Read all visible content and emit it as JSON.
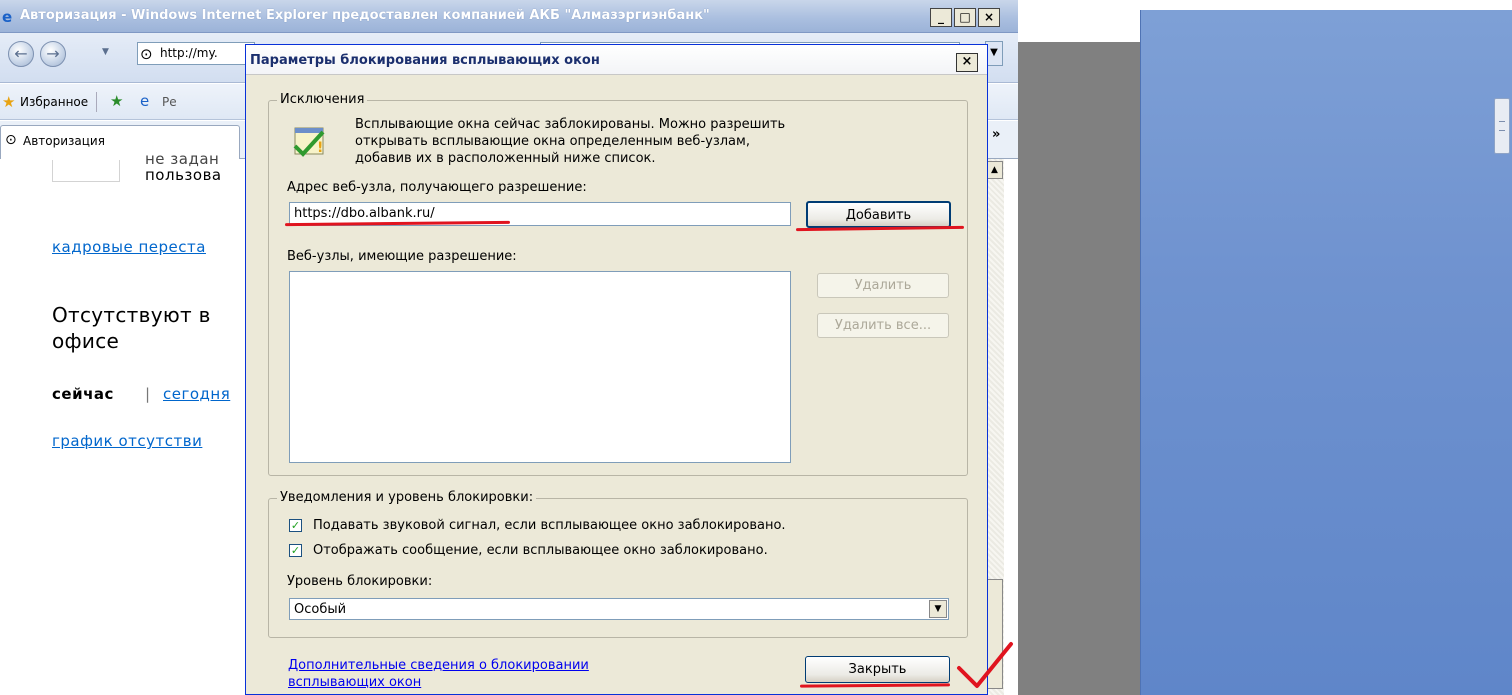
{
  "ie": {
    "title": "Авторизация - Windows Internet Explorer предоставлен компанией АКБ \"Алмазэргиэнбанк\"",
    "address_partial": "http://my.",
    "favorites_label": "Избранное",
    "favorites_extra": "Ре",
    "tab_label": "Авторизация",
    "more_tabs": "»"
  },
  "page": {
    "line1": "не задан",
    "line2": "пользова",
    "link_staff": "кадровые переста",
    "heading_line1": "Отсутствуют в",
    "heading_line2": "офисе",
    "now_label": "сейчас",
    "sep": "|",
    "today_link": "сегодня",
    "schedule_link": "график отсутстви"
  },
  "dialog": {
    "title": "Параметры блокирования всплывающих окон",
    "close_glyph": "×",
    "exceptions_legend": "Исключения",
    "info_line1": "Всплывающие окна сейчас заблокированы.  Можно разрешить",
    "info_line2": "открывать всплывающие окна определенным веб-узлам,",
    "info_line3": "добавив их в расположенный ниже список.",
    "address_label": "Адрес веб-узла, получающего разрешение:",
    "address_value": "https://dbo.albank.ru/",
    "add_button": "Добавить",
    "allowed_label": "Веб-узлы, имеющие разрешение:",
    "remove_button": "Удалить",
    "remove_all_button": "Удалить все...",
    "notify_legend": "Уведомления и уровень блокировки:",
    "chk_sound": "Подавать звуковой сигнал, если всплывающее окно заблокировано.",
    "chk_sound_checked": true,
    "chk_message": "Отображать сообщение, если всплывающее окно заблокировано.",
    "chk_message_checked": true,
    "level_label": "Уровень блокировки:",
    "level_value": "Особый",
    "more_info_line1": "Дополнительные сведения о блокировании",
    "more_info_line2": "всплывающих окон",
    "close_button": "Закрыть"
  },
  "colors": {
    "annotation_red": "#e0141f",
    "desktop_blue": "#6f92cf",
    "link_blue": "#0066cc"
  }
}
